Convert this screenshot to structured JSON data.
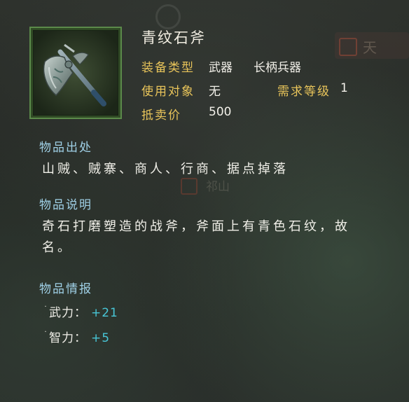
{
  "item": {
    "name": "青纹石斧",
    "icon": "battle-axe-icon"
  },
  "stats": {
    "equip_type_label": "装备类型",
    "equip_type_value": "武器",
    "equip_subtype_value": "长柄兵器",
    "target_label": "使用对象",
    "target_value": "无",
    "req_level_label": "需求等级",
    "req_level_value": "1",
    "sell_price_label": "抵卖价",
    "sell_price_value": "500"
  },
  "sources": {
    "header": "物品出处",
    "text": "山贼、贼寨、商人、行商、据点掉落"
  },
  "description": {
    "header": "物品说明",
    "line1": "奇石打磨塑造的战斧，斧面上有青色石纹，故",
    "line2": "名。"
  },
  "info": {
    "header": "物品情报",
    "attributes": [
      {
        "dot": "˙",
        "name": "武力",
        "colon": "：",
        "value": "+21"
      },
      {
        "dot": "˙",
        "name": "智力",
        "colon": "：",
        "value": "+5"
      }
    ]
  },
  "background": {
    "badge_char": "天",
    "marker_text": "祁山"
  },
  "colors": {
    "label_gold": "#e8c45a",
    "header_blue": "#9fd0e6",
    "value_cyan": "#48c6d6",
    "frame_green": "#5b8a4a"
  }
}
